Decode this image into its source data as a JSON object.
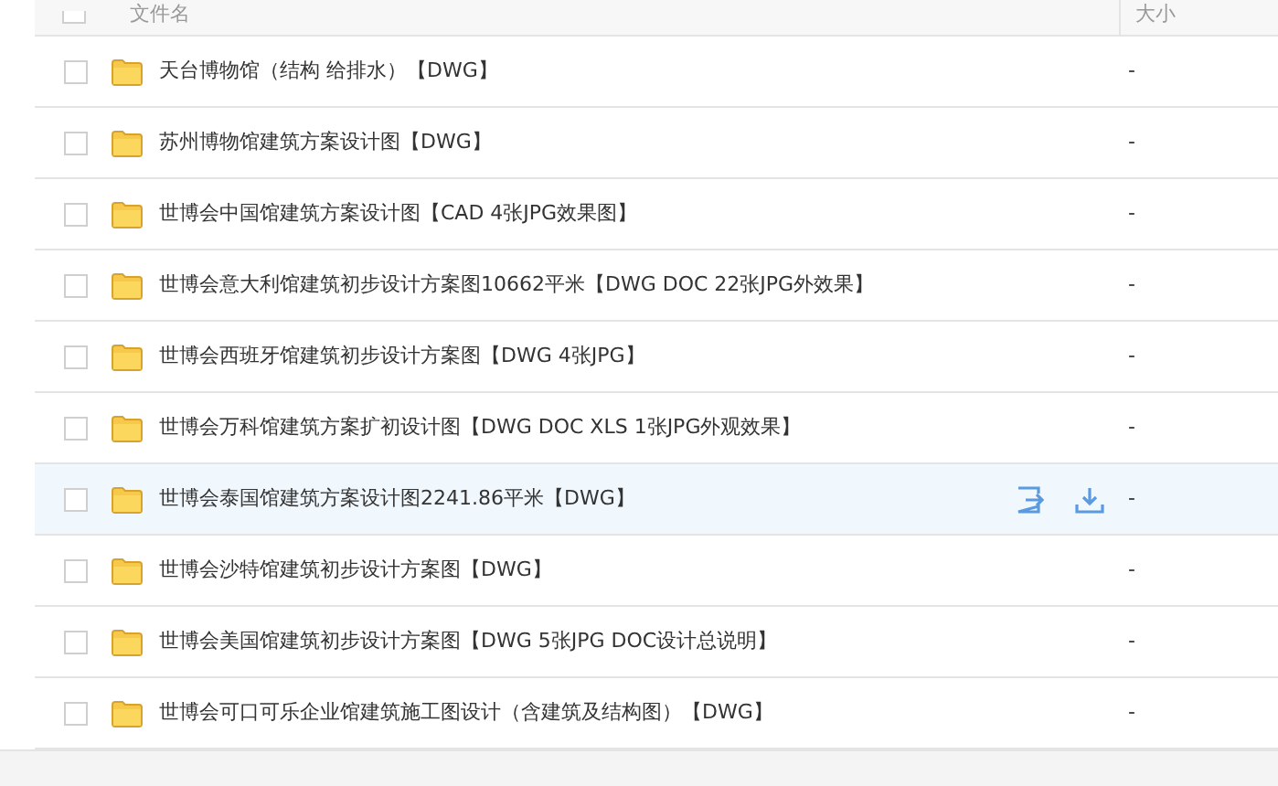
{
  "table": {
    "columns": [
      "文件名",
      "大小"
    ],
    "select_all_checked": false,
    "rows": [
      {
        "name": "天台博物馆（结构 给排水）【DWG】",
        "size": "-",
        "checked": false,
        "hovered": false
      },
      {
        "name": "苏州博物馆建筑方案设计图【DWG】",
        "size": "-",
        "checked": false,
        "hovered": false
      },
      {
        "name": "世博会中国馆建筑方案设计图【CAD 4张JPG效果图】",
        "size": "-",
        "checked": false,
        "hovered": false
      },
      {
        "name": "世博会意大利馆建筑初步设计方案图10662平米【DWG DOC 22张JPG外效果】",
        "size": "-",
        "checked": false,
        "hovered": false
      },
      {
        "name": "世博会西班牙馆建筑初步设计方案图【DWG 4张JPG】",
        "size": "-",
        "checked": false,
        "hovered": false
      },
      {
        "name": "世博会万科馆建筑方案扩初设计图【DWG DOC XLS 1张JPG外观效果】",
        "size": "-",
        "checked": false,
        "hovered": false
      },
      {
        "name": "世博会泰国馆建筑方案设计图2241.86平米【DWG】",
        "size": "-",
        "checked": false,
        "hovered": true
      },
      {
        "name": "世博会沙特馆建筑初步设计方案图【DWG】",
        "size": "-",
        "checked": false,
        "hovered": false
      },
      {
        "name": "世博会美国馆建筑初步设计方案图【DWG 5张JPG DOC设计总说明】",
        "size": "-",
        "checked": false,
        "hovered": false
      },
      {
        "name": "世博会可口可乐企业馆建筑施工图设计（含建筑及结构图）【DWG】",
        "size": "-",
        "checked": false,
        "hovered": false
      }
    ]
  }
}
